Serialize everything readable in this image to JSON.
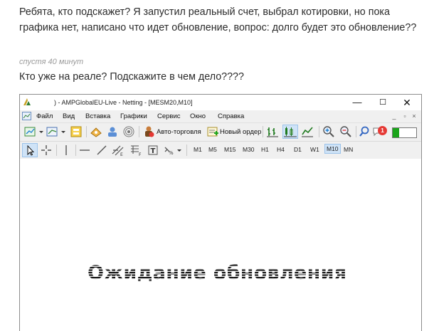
{
  "post1": {
    "text": "Ребята, кто подскажет? Я запустил реальный счет, выбрал котировки, но пока графика нет, написано что идет обновление, вопрос: долго будет это обновление??"
  },
  "meta": {
    "time": "спустя 40 минут"
  },
  "post2": {
    "text": "Кто уже на реале? Подскажите в чем дело????"
  },
  "window": {
    "title": ") - AMPGlobalEU-Live - Netting - [MESM20,M10]",
    "controls": {
      "minimize": "—",
      "maximize": "☐",
      "close": "✕"
    },
    "menu": [
      "Файл",
      "Вид",
      "Вставка",
      "Графики",
      "Сервис",
      "Окно",
      "Справка"
    ],
    "mdi": {
      "minimize": "_",
      "restore": "▫",
      "close": "×"
    },
    "toolbar1": {
      "autotrading": "Авто-торговля",
      "new_order": "Новый ордер",
      "alert_count": "1"
    },
    "timeframes": [
      "M1",
      "M5",
      "M15",
      "M30",
      "H1",
      "H4",
      "D1",
      "W1",
      "M10",
      "MN"
    ],
    "active_timeframe": "M10",
    "chart": {
      "status": "Ожидание обновления"
    }
  },
  "colors": {
    "accent_green": "#1aa51a",
    "alert_red": "#e53935",
    "active_tf_bg": "#cfe3f7"
  }
}
